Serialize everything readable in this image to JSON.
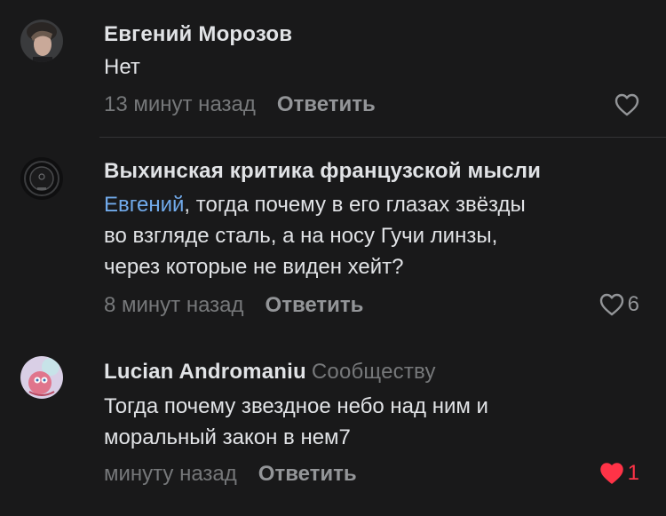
{
  "comments": [
    {
      "author": "Евгений Морозов",
      "text": "Нет",
      "time": "13 минут назад",
      "reply_label": "Ответить",
      "like_count": "",
      "liked": false
    },
    {
      "author": "Выхинская критика французской мысли",
      "mention": "Евгений",
      "text_line1": ", тогда почему в его глазах звёзды",
      "text_line2": "во взгляде сталь, а на носу Гучи линзы,",
      "text_line3": "через которые не виден хейт?",
      "time": "8 минут назад",
      "reply_label": "Ответить",
      "like_count": "6",
      "liked": false
    },
    {
      "author": "Lucian Andromaniu",
      "author_suffix": "Сообществу",
      "text_line1": "Тогда почему звездное небо над ним и",
      "text_line2": "моральный закон в нем7",
      "time": "минуту назад",
      "reply_label": "Ответить",
      "like_count": "1",
      "liked": true
    }
  ],
  "colors": {
    "background": "#19191a",
    "text_primary": "#e1e3e6",
    "text_secondary": "#76787a",
    "mention": "#71aaeb",
    "like_active": "#ff3347"
  }
}
